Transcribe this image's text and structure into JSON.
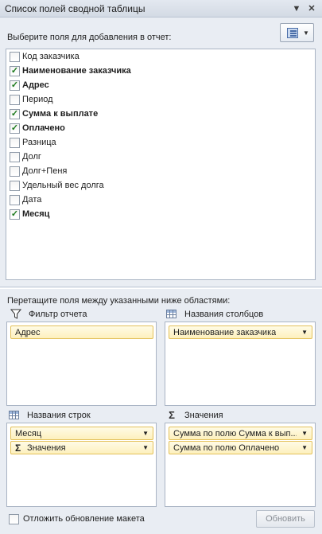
{
  "panel": {
    "title": "Список полей сводной таблицы",
    "title_dropdown_icon": "chevron-down-icon",
    "close_icon": "close-icon",
    "choose_fields_label": "Выберите поля для добавления в отчет:",
    "layout_button_icon": "layout-icon",
    "fields": [
      {
        "label": "Код заказчика",
        "checked": false
      },
      {
        "label": "Наименование заказчика",
        "checked": true
      },
      {
        "label": "Адрес",
        "checked": true
      },
      {
        "label": "Период",
        "checked": false
      },
      {
        "label": "Сумма к выплате",
        "checked": true
      },
      {
        "label": "Оплачено",
        "checked": true
      },
      {
        "label": "Разница",
        "checked": false
      },
      {
        "label": "Долг",
        "checked": false
      },
      {
        "label": "Долг+Пеня",
        "checked": false
      },
      {
        "label": "Удельный вес долга",
        "checked": false
      },
      {
        "label": "Дата",
        "checked": false
      },
      {
        "label": "Месяц",
        "checked": true
      }
    ],
    "drag_label": "Перетащите поля между указанными ниже областями:"
  },
  "areas": {
    "report_filter": {
      "label": "Фильтр отчета",
      "icon": "filter-icon",
      "items": [
        "Адрес"
      ]
    },
    "column_labels": {
      "label": "Названия столбцов",
      "icon": "grid-icon",
      "items": [
        "Наименование заказчика"
      ]
    },
    "row_labels": {
      "label": "Названия строк",
      "icon": "grid-icon",
      "items": [
        "Месяц",
        "Значения"
      ]
    },
    "values": {
      "label": "Значения",
      "icon": "sigma-icon",
      "items": [
        "Сумма по полю Сумма к вып...",
        "Сумма по полю Оплачено"
      ]
    }
  },
  "footer": {
    "defer_label": "Отложить обновление макета",
    "defer_checked": false,
    "update_button": "Обновить"
  },
  "colors": {
    "check": "#1c7a1c",
    "chip_border": "#e3c15a",
    "chip_fill": "#fdf0bd"
  }
}
